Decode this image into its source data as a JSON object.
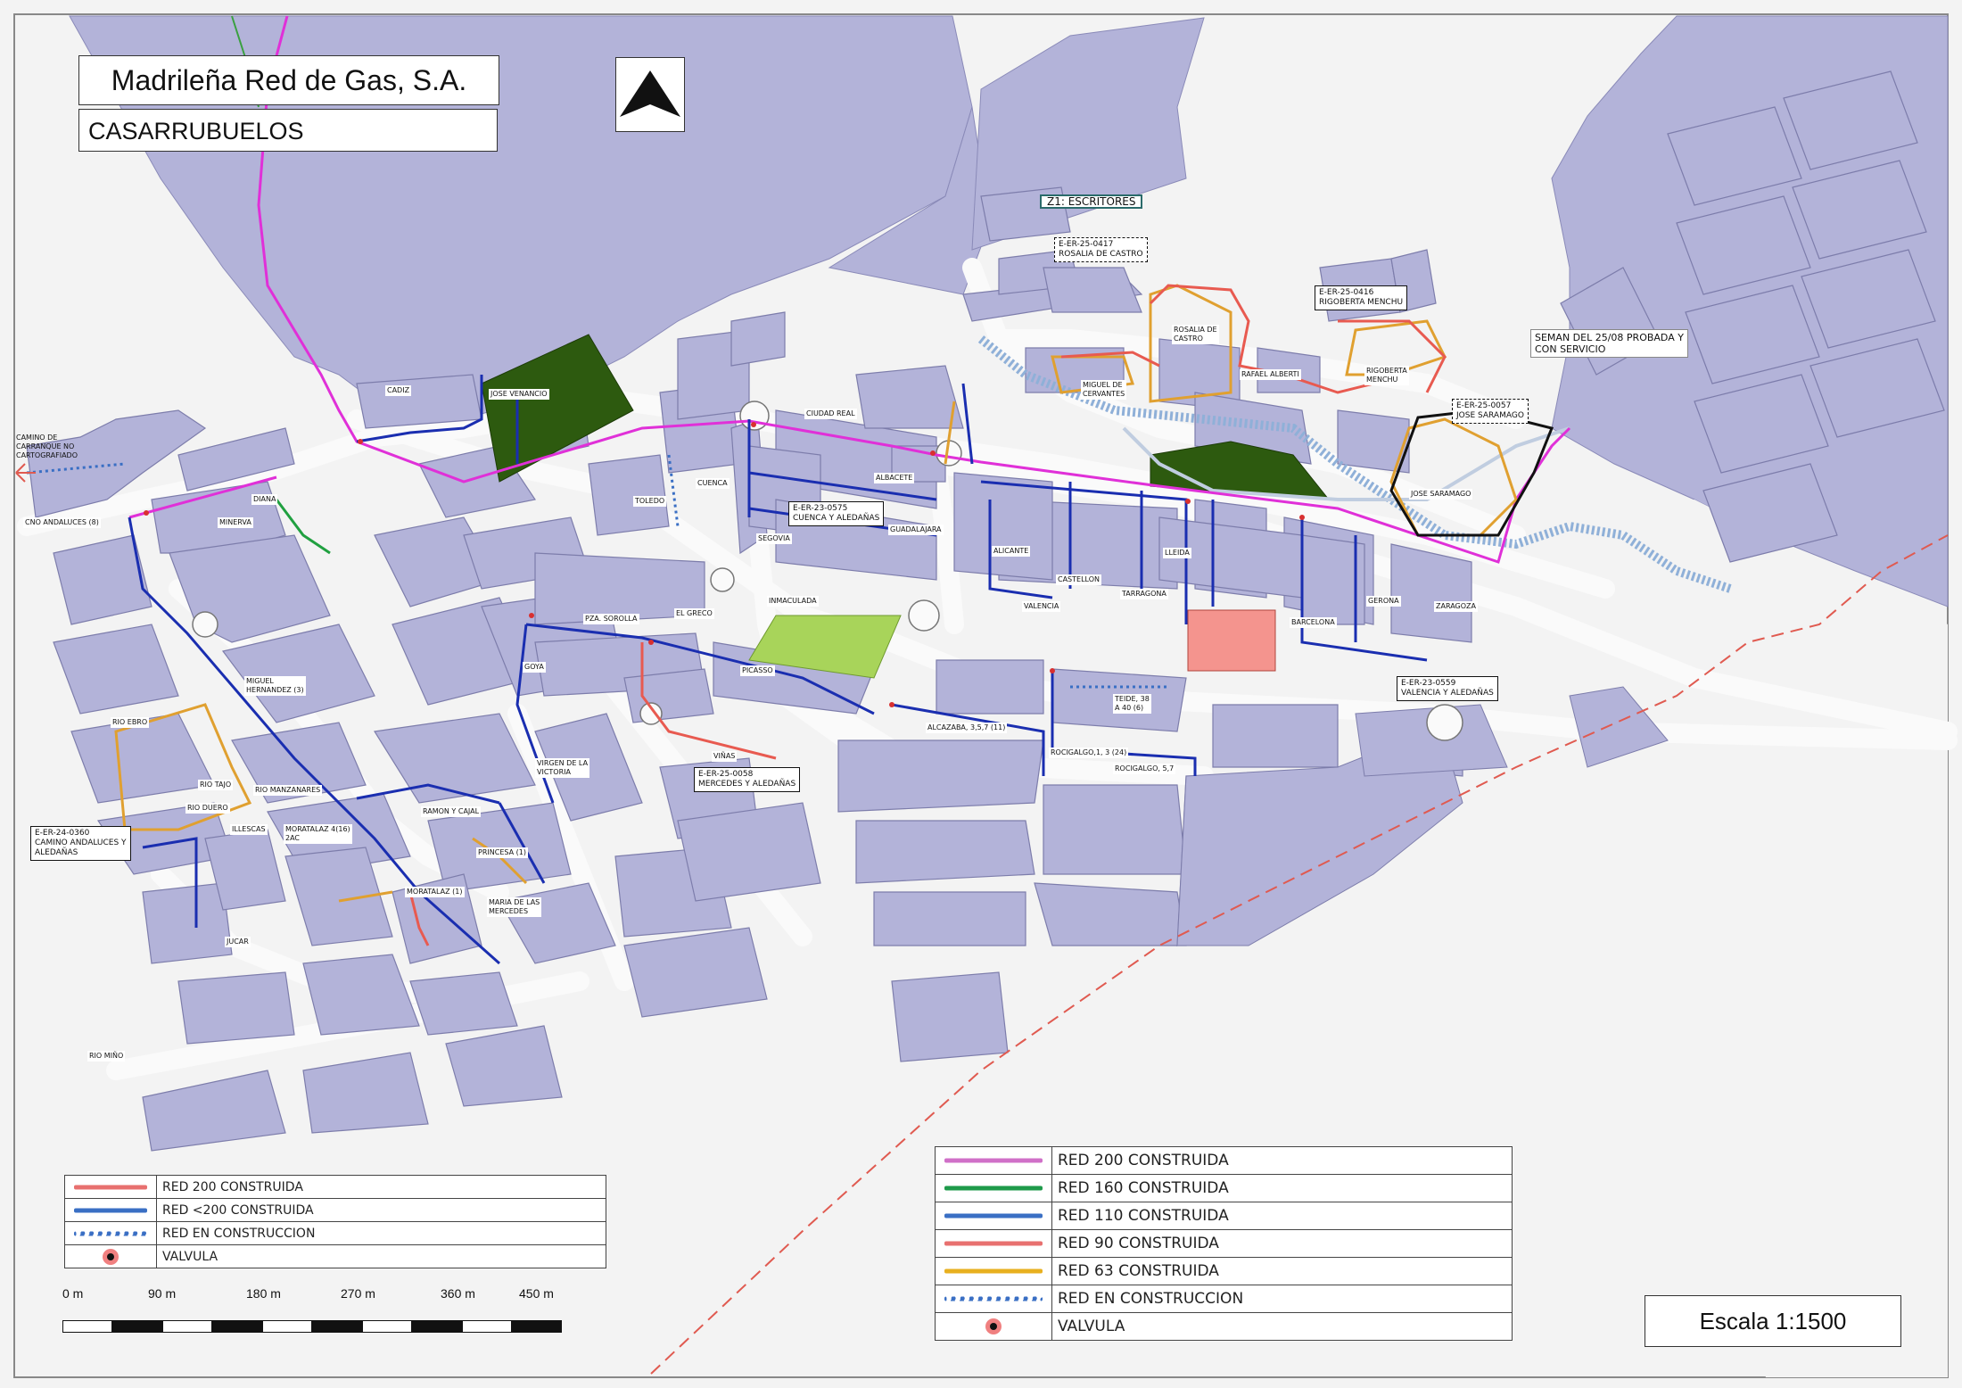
{
  "header": {
    "company": "Madrileña Red de Gas, S.A.",
    "town": "CASARRUBUELOS"
  },
  "zone": "Z1: ESCRITORES",
  "callouts": {
    "rosalia": "E-ER-25-0417\nROSALIA DE CASTRO",
    "rigoberta": "E-ER-25-0416\nRIGOBERTA MENCHU",
    "note": "SEMAN DEL 25/08 PROBADA Y\nCON SERVICIO",
    "jose": "E-ER-25-0057\nJOSE SARAMAGO",
    "cuenca": "E-ER-23-0575\nCUENCA Y ALEDAÑAS",
    "valencia": "E-ER-23-0559\nVALENCIA Y ALEDAÑAS",
    "mercedes": "E-ER-25-0058\nMERCEDES Y ALEDAÑAS",
    "camino": "E-ER-24-0360\nCAMINO ANDALUCES Y\nALEDAÑAS"
  },
  "streets": {
    "camino_carranque": "CAMINO DE\nCARRANQUE NO\nCARTOGRAFIADO",
    "cno_andaluces": "CNO ANDALUCES (8)",
    "cadiz": "CADIZ",
    "jose_venancio": "JOSE VENANCIO",
    "diana": "DIANA",
    "minerva": "MINERVA",
    "ciudad_real": "CIUDAD REAL",
    "cuenca": "CUENCA",
    "toledo": "TOLEDO",
    "albacete": "ALBACETE",
    "segovia": "SEGOVIA",
    "guadalajara": "GUADALAJARA",
    "alicante": "ALICANTE",
    "castellon": "CASTELLON",
    "tarragona": "TARRAGONA",
    "lleida": "LLEIDA",
    "valencia": "VALENCIA",
    "barcelona": "BARCELONA",
    "gerona": "GERONA",
    "zaragoza": "ZARAGOZA",
    "inmaculada": "INMACULADA",
    "pza_sorolla": "PZA. SOROLLA",
    "el_greco": "EL GRECO",
    "goya": "GOYA",
    "picasso": "PICASSO",
    "vinas": "VIÑAS",
    "miguel_hernandez": "MIGUEL\nHERNANDEZ (3)",
    "rio_ebro": "RIO EBRO",
    "rio_tajo": "RIO TAJO",
    "rio_manzanares": "RIO MANZANARES",
    "rio_duero": "RIO DUERO",
    "illescas": "ILLESCAS",
    "moratalaz_4": "MORATALAZ 4(16)\n2AC",
    "ramon_cajal": "RAMON Y CAJAL",
    "virgen_victoria": "VIRGEN DE LA\nVICTORIA",
    "princesa": "PRINCESA (1)",
    "moratalaz_1": "MORATALAZ (1)",
    "maria_mercedes": "MARIA DE LAS\nMERCEDES",
    "jucar": "JUCAR",
    "rio_mino": "RIO MIÑO",
    "alcazaba": "ALCAZABA, 3,5,7 (11)",
    "rocigalgo_13": "ROCIGALGO,1, 3 (24)",
    "rocigalgo_57": "ROCIGALGO, 5,7",
    "teide": "TEIDE, 38\nA 40 (6)",
    "rosalia_castro": "ROSALIA DE\nCASTRO",
    "miguel_cervantes": "MIGUEL DE\nCERVANTES",
    "rafael_alberti": "RAFAEL ALBERTI",
    "rigoberta_menchu": "RIGOBERTA\nMENCHU",
    "jose_saramago": "JOSE SARAMAGO"
  },
  "legend_left": [
    {
      "label": "RED 200 CONSTRUIDA",
      "color": "#e8706f",
      "style": "solid"
    },
    {
      "label": "RED <200 CONSTRUIDA",
      "color": "#3a6fc4",
      "style": "solid"
    },
    {
      "label": "RED EN CONSTRUCCION",
      "color": "#3a6fc4",
      "style": "dotted"
    },
    {
      "label": "VALVULA",
      "color": "#f08080",
      "style": "valve"
    }
  ],
  "legend_right": [
    {
      "label": "RED 200 CONSTRUIDA",
      "color": "#d070c8",
      "style": "solid"
    },
    {
      "label": "RED 160 CONSTRUIDA",
      "color": "#1e9a4a",
      "style": "solid"
    },
    {
      "label": "RED 110 CONSTRUIDA",
      "color": "#3a6fc4",
      "style": "solid"
    },
    {
      "label": "RED 90 CONSTRUIDA",
      "color": "#e8706f",
      "style": "solid"
    },
    {
      "label": "RED 63 CONSTRUIDA",
      "color": "#e8b020",
      "style": "solid"
    },
    {
      "label": "RED EN CONSTRUCCION",
      "color": "#3a6fc4",
      "style": "dotted"
    },
    {
      "label": "VALVULA",
      "color": "#f08080",
      "style": "valve"
    }
  ],
  "scale_ticks": [
    "0 m",
    "90 m",
    "180 m",
    "270 m",
    "360 m",
    "450 m"
  ],
  "scale_text": "Escala 1:1500",
  "colors": {
    "block": "#b3b3d9",
    "road": "#f2f2f2",
    "park": "#2d5a0f",
    "field": "#a8d45a",
    "pipe200": "#e030d8",
    "pipe110": "#1a2eb0",
    "pipe63": "#e0a030",
    "pipe90": "#e85a50",
    "pipe160": "#20a040",
    "building": "#f4948e"
  }
}
